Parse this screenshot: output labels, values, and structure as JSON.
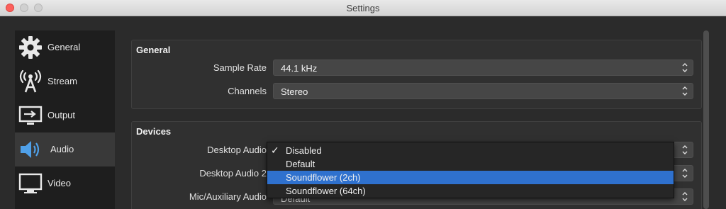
{
  "window": {
    "title": "Settings"
  },
  "sidebar": {
    "items": [
      {
        "label": "General",
        "icon": "gear-icon"
      },
      {
        "label": "Stream",
        "icon": "broadcast-tower-icon"
      },
      {
        "label": "Output",
        "icon": "output-monitor-icon"
      },
      {
        "label": "Audio",
        "icon": "speaker-icon",
        "active": true
      },
      {
        "label": "Video",
        "icon": "monitor-icon"
      }
    ]
  },
  "general": {
    "title": "General",
    "sample_rate_label": "Sample Rate",
    "sample_rate_value": "44.1 kHz",
    "channels_label": "Channels",
    "channels_value": "Stereo"
  },
  "devices": {
    "title": "Devices",
    "desktop_audio_label": "Desktop Audio",
    "desktop_audio_2_label": "Desktop Audio 2",
    "mic_aux_label": "Mic/Auxiliary Audio",
    "mic_aux_value": "Default"
  },
  "dropdown": {
    "options": [
      "Disabled",
      "Default",
      "Soundflower (2ch)",
      "Soundflower (64ch)"
    ],
    "checked": "Disabled",
    "highlighted": "Soundflower (2ch)",
    "check_mark": "✓"
  },
  "colors": {
    "highlight": "#2f71ce",
    "close_button": "#fc605c"
  }
}
